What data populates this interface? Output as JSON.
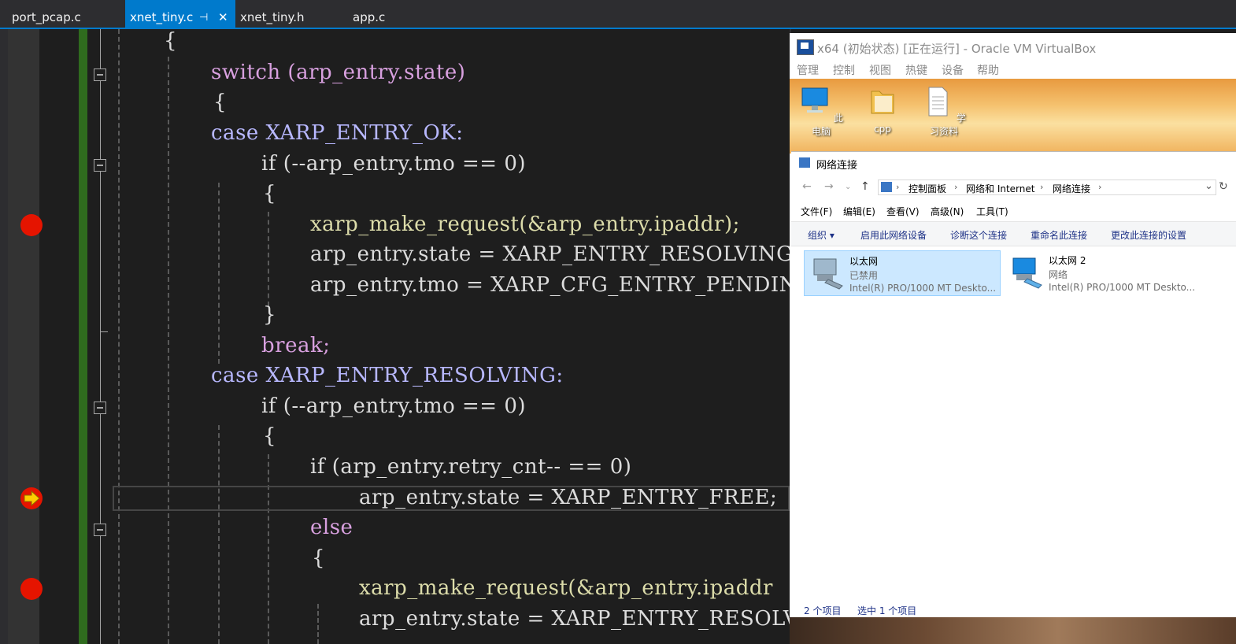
{
  "ide": {
    "tabs": [
      {
        "label": "port_pcap.c",
        "active": false
      },
      {
        "label": "xnet_tiny.c",
        "active": true,
        "pin": "⊣",
        "close": "✕"
      },
      {
        "label": "xnet_tiny.h",
        "active": false
      },
      {
        "label": "app.c",
        "active": false
      }
    ],
    "code_lines": [
      "{",
      "switch (arp_entry.state)",
      "{",
      "case XARP_ENTRY_OK:",
      "if (--arp_entry.tmo == 0)",
      "{",
      "xarp_make_request(&arp_entry.ipaddr);",
      "arp_entry.state = XARP_ENTRY_RESOLVING;",
      "arp_entry.tmo = XARP_CFG_ENTRY_PENDING_",
      "}",
      "break;",
      "case XARP_ENTRY_RESOLVING:",
      "if (--arp_entry.tmo == 0)",
      "{",
      "if (arp_entry.retry_cnt-- == 0)",
      "arp_entry.state = XARP_ENTRY_FREE;",
      "else",
      "{",
      "xarp_make_request(&arp_entry.ipaddr",
      "arp_entry.state = XARP_ENTRY_RESOLV"
    ],
    "colors": {
      "accent": "#007acc",
      "breakpoint": "#e51400",
      "change_bar": "#2f6b1e"
    }
  },
  "vbox": {
    "title": "x64 (初始状态) [正在运行] - Oracle VM VirtualBox",
    "menu": [
      "管理",
      "控制",
      "视图",
      "热键",
      "设备",
      "帮助"
    ],
    "desktop_icons": [
      {
        "label": "此电脑",
        "icon": "computer-icon"
      },
      {
        "label": "cpp",
        "icon": "folder-icon"
      },
      {
        "label": "学习资料",
        "icon": "document-icon"
      }
    ],
    "net_window": {
      "title": "网络连接",
      "breadcrumb": [
        "控制面板",
        "网络和 Internet",
        "网络连接"
      ],
      "menu": [
        "文件(F)",
        "编辑(E)",
        "查看(V)",
        "高级(N)",
        "工具(T)"
      ],
      "commands": [
        "组织 ▾",
        "启用此网络设备",
        "诊断这个连接",
        "重命名此连接",
        "更改此连接的设置"
      ],
      "adapters": [
        {
          "name": "以太网",
          "status": "已禁用",
          "device": "Intel(R) PRO/1000 MT Deskto...",
          "selected": true
        },
        {
          "name": "以太网 2",
          "status": "网络",
          "device": "Intel(R) PRO/1000 MT Deskto...",
          "selected": false
        }
      ],
      "status": {
        "count": "2 个项目",
        "selected": "选中 1 个项目"
      }
    }
  }
}
